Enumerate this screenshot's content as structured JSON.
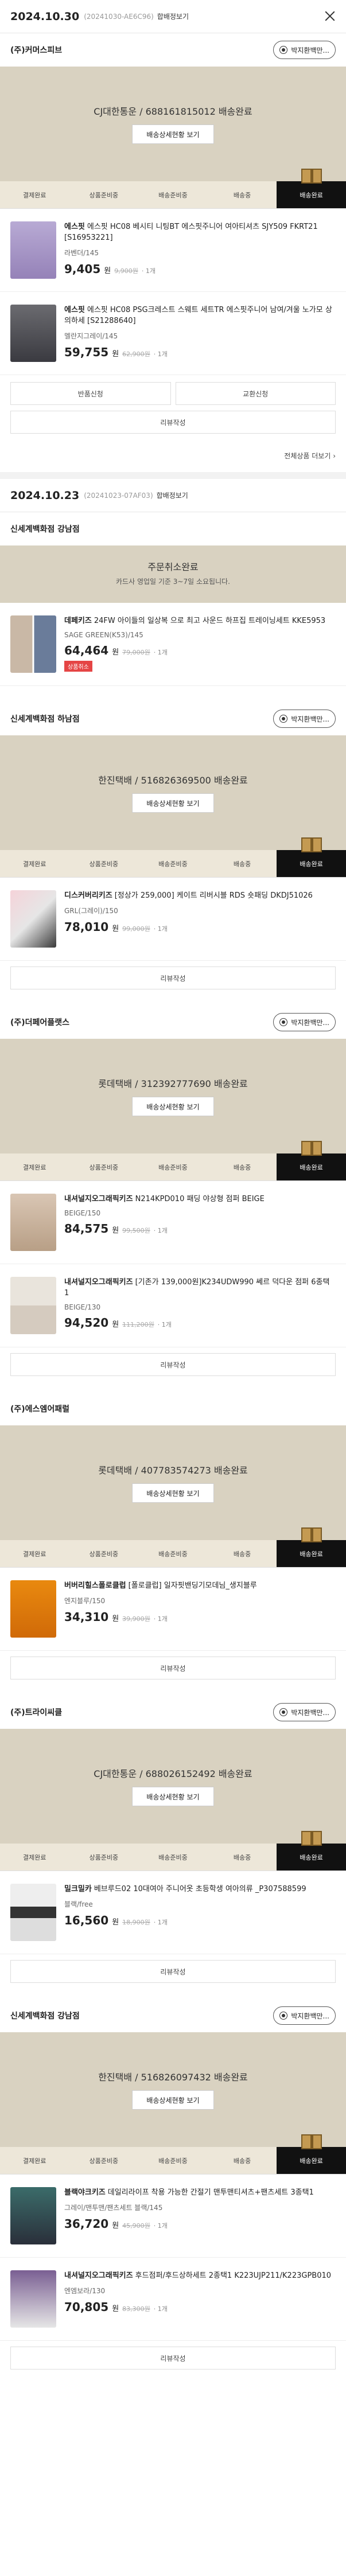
{
  "orders": [
    {
      "date": "2024.10.30",
      "order_no": "(20241030-AE6C96)",
      "merge_label": "합배정보기",
      "all_view_label": "전체상품 더보기",
      "packages": [
        {
          "seller": "(주)커머스피브",
          "talk_label": "박지환백만...",
          "status": "CJ대한통운 / 688161815012 배송완료",
          "sub": "",
          "track_label": "배송상세현황 보기",
          "steps": [
            "결제완료",
            "상품준비중",
            "배송준비중",
            "배송중",
            "배송완료"
          ],
          "items": [
            {
              "brand": "에스핏",
              "name": "에스핏 HC08 베시티 니팅BT 에스핏주니어 여아티셔츠 SJY509 FKRT21 [S16953221]",
              "option": "라벤더/145",
              "price": "9,405",
              "unit": "원",
              "orig": "9,900원",
              "qty": "· 1개",
              "badge": "",
              "thumb": "a"
            },
            {
              "brand": "에스핏",
              "name": "에스핏 HC08 PSG크레스트 스웨트 세트TR 에스핏주니어 남여/겨울 노가모 상의하세 [S21288640]",
              "option": "멜란지그레이/145",
              "price": "59,755",
              "unit": "원",
              "orig": "62,900원",
              "qty": "· 1개",
              "badge": "",
              "thumb": "b"
            }
          ],
          "buttons": [
            "반품신청",
            "교환신청"
          ],
          "review_label": "리뷰작성"
        }
      ]
    },
    {
      "date": "2024.10.23",
      "order_no": "(20241023-07AF03)",
      "merge_label": "합배정보기",
      "all_view_label": "",
      "packages": [
        {
          "seller": "신세계백화점 강남점",
          "talk_label": "",
          "status": "주문취소완료",
          "sub": "카드사 영업일 기준 3~7일 소요됩니다.",
          "track_label": "",
          "steps": [],
          "items": [
            {
              "brand": "데페키즈",
              "name": "24FW 아이들의 일상복 으로 최고 사운드 하프집 트레이닝세트 KKE5953",
              "option": "SAGE GREEN(K53)/145",
              "price": "64,464",
              "unit": "원",
              "orig": "79,000원",
              "qty": "· 1개",
              "badge": "상품취소",
              "thumb": "c"
            }
          ],
          "buttons": [],
          "review_label": ""
        },
        {
          "seller": "신세계백화점 하남점",
          "talk_label": "박지환백만...",
          "status": "한진택배 / 516826369500 배송완료",
          "sub": "",
          "track_label": "배송상세현황 보기",
          "steps": [
            "결제완료",
            "상품준비중",
            "배송준비중",
            "배송중",
            "배송완료"
          ],
          "items": [
            {
              "brand": "디스커버리키즈",
              "name": "[정상가 259,000] 케이트 리버시블 RDS 숏패딩 DKDJ51026",
              "option": "GRL(그레이)/150",
              "price": "78,010",
              "unit": "원",
              "orig": "99,000원",
              "qty": "· 1개",
              "badge": "",
              "thumb": "d"
            }
          ],
          "buttons": [],
          "review_label": "리뷰작성"
        },
        {
          "seller": "(주)더페어플랫스",
          "talk_label": "박지환백만...",
          "status": "롯데택배 / 312392777690 배송완료",
          "sub": "",
          "track_label": "배송상세현황 보기",
          "steps": [
            "결제완료",
            "상품준비중",
            "배송준비중",
            "배송중",
            "배송완료"
          ],
          "items": [
            {
              "brand": "내셔널지오그래픽키즈",
              "name": "N214KPD010 패딩 야상형 점퍼 BEIGE",
              "option": "BEIGE/150",
              "price": "84,575",
              "unit": "원",
              "orig": "99,500원",
              "qty": "· 1개",
              "badge": "",
              "thumb": "e"
            },
            {
              "brand": "내셔널지오그래픽키즈",
              "name": "[기존가 139,000원]K234UDW990 쎄르 덕다운 점퍼 6종택 1",
              "option": "BEIGE/130",
              "price": "94,520",
              "unit": "원",
              "orig": "111,200원",
              "qty": "· 1개",
              "badge": "",
              "thumb": "f"
            }
          ],
          "buttons": [],
          "review_label": "리뷰작성"
        },
        {
          "seller": "(주)에스엠어패럴",
          "talk_label": "",
          "status": "롯데택배 / 407783574273 배송완료",
          "sub": "",
          "track_label": "배송상세현황 보기",
          "steps": [
            "결제완료",
            "상품준비중",
            "배송준비중",
            "배송중",
            "배송완료"
          ],
          "items": [
            {
              "brand": "버버리힐스폴로클럽",
              "name": "[폴로클럽] 일자핏밴딩기모데님_생지블루",
              "option": "엔지블루/150",
              "price": "34,310",
              "unit": "원",
              "orig": "39,900원",
              "qty": "· 1개",
              "badge": "",
              "thumb": "g"
            }
          ],
          "buttons": [],
          "review_label": "리뷰작성"
        },
        {
          "seller": "(주)트라이씨클",
          "talk_label": "박지환백만...",
          "status": "CJ대한통운 / 688026152492 배송완료",
          "sub": "",
          "track_label": "배송상세현황 보기",
          "steps": [
            "결제완료",
            "상품준비중",
            "배송준비중",
            "배송중",
            "배송완료"
          ],
          "items": [
            {
              "brand": "밀크밀카",
              "name": "베브루드02 10대여아 주니어옷 초등학생 여아의류 _P307588599",
              "option": "블랙/free",
              "price": "16,560",
              "unit": "원",
              "orig": "18,900원",
              "qty": "· 1개",
              "badge": "",
              "thumb": "h"
            }
          ],
          "buttons": [],
          "review_label": "리뷰작성"
        },
        {
          "seller": "신세계백화점 강남점",
          "talk_label": "박지환백만...",
          "status": "한진택배 / 516826097432 배송완료",
          "sub": "",
          "track_label": "배송상세현황 보기",
          "steps": [
            "결제완료",
            "상품준비중",
            "배송준비중",
            "배송중",
            "배송완료"
          ],
          "items": [
            {
              "brand": "블랙야크키즈",
              "name": "데일리라이프 착용 가능한 간절기 맨투맨티셔츠+팬츠세트 3종택1",
              "option": "그레이/맨투맨/팬츠세트 블랙/145",
              "price": "36,720",
              "unit": "원",
              "orig": "45,900원",
              "qty": "· 1개",
              "badge": "",
              "thumb": "i"
            },
            {
              "brand": "내셔널지오그래픽키즈",
              "name": "후드점퍼/후드상하세트 2종택1 K223UJP211/K223GPB010",
              "option": "엔엠보라/130",
              "price": "70,805",
              "unit": "원",
              "orig": "83,300원",
              "qty": "· 1개",
              "badge": "",
              "thumb": "j"
            }
          ],
          "buttons": [],
          "review_label": "리뷰작성"
        }
      ]
    }
  ]
}
